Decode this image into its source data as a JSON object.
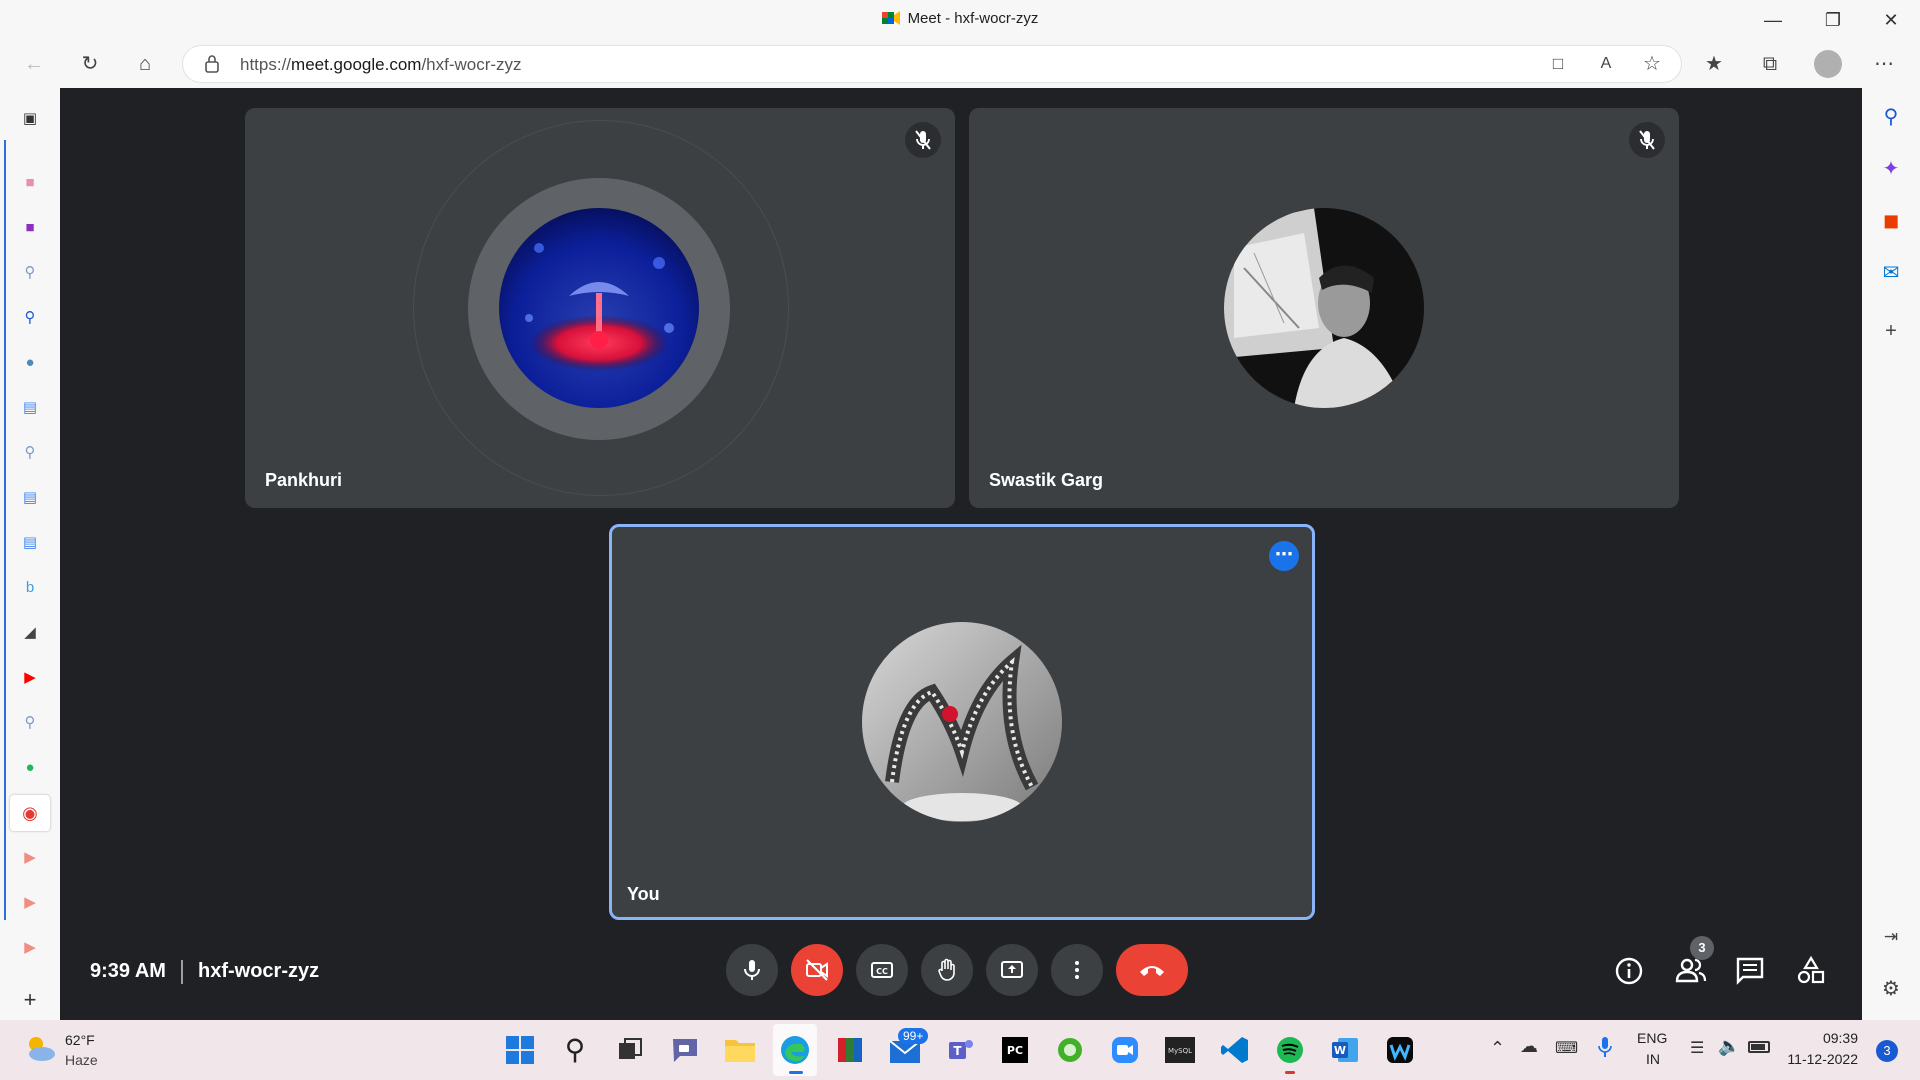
{
  "window": {
    "title": "Meet - hxf-wocr-zyz"
  },
  "browser": {
    "url_prefix": "https://",
    "url_host": "meet.google.com",
    "url_path": "/hxf-wocr-zyz"
  },
  "participants": [
    {
      "name": "Pankhuri",
      "muted": true
    },
    {
      "name": "Swastik Garg",
      "muted": true
    },
    {
      "name": "You",
      "muted": false
    }
  ],
  "meeting": {
    "time": "9:39 AM",
    "code": "hxf-wocr-zyz",
    "participant_count": "3"
  },
  "taskbar": {
    "weather_temp": "62°F",
    "weather_desc": "Haze",
    "mail_badge": "99+",
    "lang_1": "ENG",
    "lang_2": "IN",
    "clock_time": "09:39",
    "clock_date": "11-12-2022",
    "notif_count": "3"
  },
  "colors": {
    "stage_bg": "#202124",
    "tile_bg": "#3c4043",
    "end_call": "#ea4335",
    "active_border": "#8ab4f8"
  }
}
